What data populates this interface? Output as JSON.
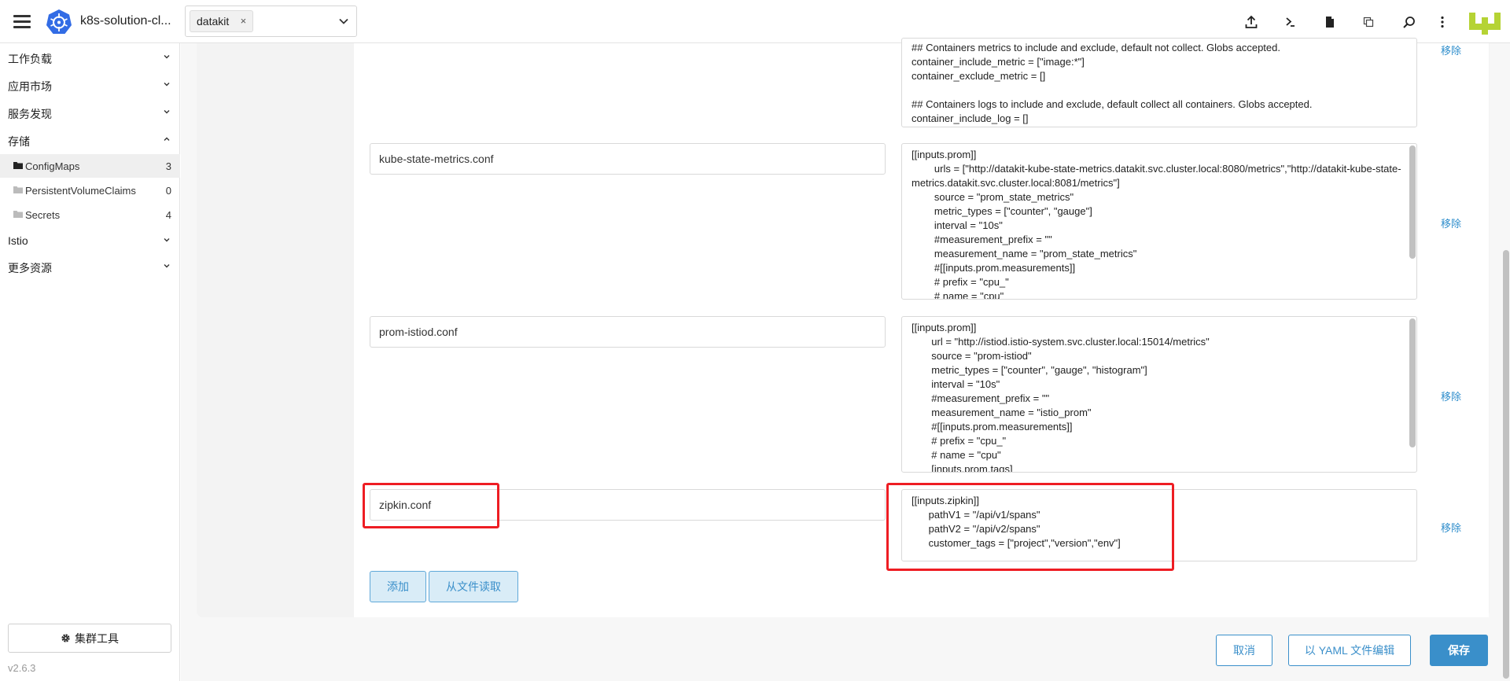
{
  "header": {
    "cluster_name": "k8s-solution-cl...",
    "namespace_tag": "datakit",
    "namespace_tag_remove": "×",
    "icons": [
      "upload-icon",
      "terminal-icon",
      "file-icon",
      "copy-icon",
      "search-icon",
      "more-vertical-icon"
    ]
  },
  "sidebar": {
    "groups": [
      {
        "label": "工作负载"
      },
      {
        "label": "应用市场"
      },
      {
        "label": "服务发现"
      },
      {
        "label": "存储"
      },
      {
        "label": "Istio"
      },
      {
        "label": "更多资源"
      }
    ],
    "storage_items": [
      {
        "label": "ConfigMaps",
        "count": "3"
      },
      {
        "label": "PersistentVolumeClaims",
        "count": "0"
      },
      {
        "label": "Secrets",
        "count": "4"
      }
    ],
    "cluster_tools": "集群工具",
    "version": "v2.6.3"
  },
  "entries": [
    {
      "key": "",
      "value": "## Containers metrics to include and exclude, default not collect. Globs accepted.\ncontainer_include_metric = [\"image:*\"]\ncontainer_exclude_metric = []\n\n## Containers logs to include and exclude, default collect all containers. Globs accepted.\ncontainer_include_log = []\ncontainer_exclude_log = [\"image:pubrepo.jiagouyun.com/datakit/logfwd*\"]",
      "remove": "移除"
    },
    {
      "key": "kube-state-metrics.conf",
      "value": "[[inputs.prom]]\n        urls = [\"http://datakit-kube-state-metrics.datakit.svc.cluster.local:8080/metrics\",\"http://datakit-kube-state-metrics.datakit.svc.cluster.local:8081/metrics\"]\n        source = \"prom_state_metrics\"\n        metric_types = [\"counter\", \"gauge\"]\n        interval = \"10s\"\n        #measurement_prefix = \"\"\n        measurement_name = \"prom_state_metrics\"\n        #[[inputs.prom.measurements]]\n        # prefix = \"cpu_\"\n        # name = \"cpu\"",
      "remove": "移除"
    },
    {
      "key": "prom-istiod.conf",
      "value": "[[inputs.prom]]\n       url = \"http://istiod.istio-system.svc.cluster.local:15014/metrics\"\n       source = \"prom-istiod\"\n       metric_types = [\"counter\", \"gauge\", \"histogram\"]\n       interval = \"10s\"\n       #measurement_prefix = \"\"\n       measurement_name = \"istio_prom\"\n       #[[inputs.prom.measurements]]\n       # prefix = \"cpu_\"\n       # name = \"cpu\"\n       [inputs.prom.tags]",
      "remove": "移除"
    },
    {
      "key": "zipkin.conf",
      "value": "[[inputs.zipkin]]\n      pathV1 = \"/api/v1/spans\"\n      pathV2 = \"/api/v2/spans\"\n      customer_tags = [\"project\",\"version\",\"env\"]",
      "remove": "移除"
    }
  ],
  "actions": {
    "add": "添加",
    "read_from_file": "从文件读取",
    "cancel": "取消",
    "edit_yaml": "以 YAML 文件编辑",
    "save": "保存"
  },
  "colors": {
    "accent": "#3a8fca",
    "highlight": "#ee1d23"
  }
}
